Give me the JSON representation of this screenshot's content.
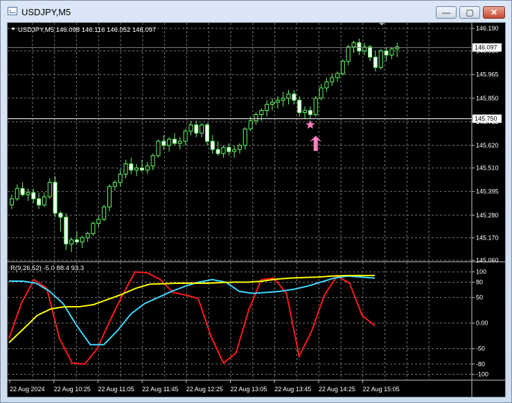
{
  "window": {
    "title": "USDJPY,M5",
    "minimize_label": "—",
    "maximize_label": "▢",
    "close_label": "✕"
  },
  "chart_data": [
    {
      "type": "candlestick",
      "header": "USDJPY,M5  146.098 146.116 146.052 146.097",
      "ylim": [
        145.06,
        146.19
      ],
      "yticks": [
        "146.190",
        "146.080",
        "145.965",
        "145.850",
        "145.735",
        "145.620",
        "145.510",
        "145.395",
        "145.280",
        "145.170",
        "145.060"
      ],
      "current_price_label": "146.097",
      "current_price": 146.097,
      "hline_label": "145.750",
      "hline_value": 145.75,
      "bullish_color": "#66ff66",
      "bearish_color": "#ffffff",
      "candles": [
        [
          145.33,
          145.38,
          145.31,
          145.36
        ],
        [
          145.36,
          145.43,
          145.35,
          145.41
        ],
        [
          145.41,
          145.44,
          145.37,
          145.38
        ],
        [
          145.38,
          145.41,
          145.35,
          145.39
        ],
        [
          145.39,
          145.41,
          145.34,
          145.36
        ],
        [
          145.36,
          145.39,
          145.31,
          145.33
        ],
        [
          145.33,
          145.39,
          145.32,
          145.37
        ],
        [
          145.37,
          145.46,
          145.36,
          145.44
        ],
        [
          145.44,
          145.47,
          145.27,
          145.29
        ],
        [
          145.29,
          145.3,
          145.2,
          145.27
        ],
        [
          145.27,
          145.29,
          145.11,
          145.14
        ],
        [
          145.14,
          145.17,
          145.1,
          145.16
        ],
        [
          145.16,
          145.2,
          145.14,
          145.15
        ],
        [
          145.15,
          145.18,
          145.12,
          145.17
        ],
        [
          145.17,
          145.2,
          145.15,
          145.19
        ],
        [
          145.19,
          145.25,
          145.18,
          145.24
        ],
        [
          145.24,
          145.28,
          145.22,
          145.26
        ],
        [
          145.26,
          145.33,
          145.25,
          145.32
        ],
        [
          145.32,
          145.43,
          145.3,
          145.42
        ],
        [
          145.42,
          145.45,
          145.4,
          145.44
        ],
        [
          145.44,
          145.5,
          145.42,
          145.48
        ],
        [
          145.48,
          145.55,
          145.46,
          145.53
        ],
        [
          145.53,
          145.56,
          145.48,
          145.5
        ],
        [
          145.5,
          145.53,
          145.47,
          145.51
        ],
        [
          145.51,
          145.55,
          145.49,
          145.5
        ],
        [
          145.5,
          145.54,
          145.48,
          145.52
        ],
        [
          145.52,
          145.58,
          145.5,
          145.57
        ],
        [
          145.57,
          145.65,
          145.56,
          145.64
        ],
        [
          145.64,
          145.67,
          145.6,
          145.62
        ],
        [
          145.62,
          145.66,
          145.59,
          145.65
        ],
        [
          145.65,
          145.68,
          145.62,
          145.63
        ],
        [
          145.63,
          145.66,
          145.6,
          145.64
        ],
        [
          145.64,
          145.7,
          145.62,
          145.69
        ],
        [
          145.69,
          145.74,
          145.67,
          145.72
        ],
        [
          145.72,
          145.74,
          145.66,
          145.68
        ],
        [
          145.68,
          145.73,
          145.66,
          145.72
        ],
        [
          145.72,
          145.73,
          145.62,
          145.64
        ],
        [
          145.64,
          145.67,
          145.58,
          145.6
        ],
        [
          145.6,
          145.64,
          145.57,
          145.58
        ],
        [
          145.58,
          145.62,
          145.56,
          145.61
        ],
        [
          145.61,
          145.63,
          145.57,
          145.59
        ],
        [
          145.59,
          145.62,
          145.56,
          145.6
        ],
        [
          145.6,
          145.63,
          145.58,
          145.62
        ],
        [
          145.62,
          145.71,
          145.6,
          145.7
        ],
        [
          145.7,
          145.76,
          145.69,
          145.74
        ],
        [
          145.74,
          145.78,
          145.72,
          145.77
        ],
        [
          145.77,
          145.8,
          145.74,
          145.79
        ],
        [
          145.79,
          145.84,
          145.76,
          145.82
        ],
        [
          145.82,
          145.85,
          145.79,
          145.83
        ],
        [
          145.83,
          145.86,
          145.8,
          145.84
        ],
        [
          145.84,
          145.88,
          145.81,
          145.85
        ],
        [
          145.85,
          145.89,
          145.82,
          145.87
        ],
        [
          145.87,
          145.89,
          145.82,
          145.84
        ],
        [
          145.84,
          145.86,
          145.76,
          145.78
        ],
        [
          145.78,
          145.81,
          145.75,
          145.79
        ],
        [
          145.79,
          145.81,
          145.75,
          145.77
        ],
        [
          145.77,
          145.86,
          145.76,
          145.85
        ],
        [
          145.85,
          145.92,
          145.84,
          145.9
        ],
        [
          145.9,
          145.95,
          145.88,
          145.93
        ],
        [
          145.93,
          145.97,
          145.91,
          145.95
        ],
        [
          145.95,
          145.98,
          145.93,
          145.97
        ],
        [
          145.97,
          146.04,
          145.96,
          146.03
        ],
        [
          146.03,
          146.11,
          146.01,
          146.1
        ],
        [
          146.1,
          146.13,
          146.07,
          146.12
        ],
        [
          146.12,
          146.14,
          146.06,
          146.08
        ],
        [
          146.08,
          146.12,
          146.06,
          146.1
        ],
        [
          146.1,
          146.11,
          146.03,
          146.05
        ],
        [
          146.05,
          146.08,
          145.98,
          146.0
        ],
        [
          146.0,
          146.09,
          145.99,
          146.08
        ],
        [
          146.08,
          146.1,
          146.03,
          146.06
        ],
        [
          146.06,
          146.1,
          146.04,
          146.09
        ],
        [
          146.09,
          146.12,
          146.05,
          146.1
        ]
      ],
      "markers": [
        {
          "type": "star",
          "index": 55,
          "value": 145.72,
          "color": "#ff80c0"
        },
        {
          "type": "arrow-up",
          "index": 56,
          "value": 145.63,
          "color": "#ff80c0"
        }
      ]
    },
    {
      "type": "line",
      "header": "R(9,26,52) -5.0 88.4 93.3",
      "ylim": [
        -110,
        105
      ],
      "yticks": [
        "100",
        "80",
        "50",
        "0.00",
        "-50",
        "-80",
        "-100"
      ],
      "series": [
        {
          "color": "#ff1a1a",
          "values": [
            -30,
            40,
            85,
            68,
            -30,
            -78,
            -80,
            -50,
            5,
            55,
            100,
            98,
            85,
            60,
            55,
            48,
            -25,
            -78,
            -58,
            25,
            85,
            88,
            58,
            -65,
            -15,
            55,
            92,
            78,
            15,
            -5
          ]
        },
        {
          "color": "#40d8ff",
          "values": [
            82,
            82,
            78,
            62,
            38,
            -5,
            -42,
            -42,
            -15,
            18,
            38,
            50,
            62,
            72,
            80,
            85,
            80,
            62,
            58,
            60,
            62,
            66,
            72,
            80,
            88,
            92,
            90,
            88
          ]
        },
        {
          "color": "#ffff00",
          "values": [
            -38,
            -12,
            15,
            28,
            32,
            32,
            36,
            46,
            56,
            68,
            76,
            77,
            78,
            78,
            78,
            79,
            80,
            80,
            82,
            86,
            88,
            89,
            90,
            92,
            93,
            93,
            93
          ]
        }
      ]
    }
  ],
  "time_axis": {
    "labels": [
      "22 Aug 2024",
      "22 Aug 10:25",
      "22 Aug 11:05",
      "22 Aug 11:45",
      "22 Aug 12:25",
      "22 Aug 13:05",
      "22 Aug 13:45",
      "22 Aug 14:25",
      "22 Aug 15:05"
    ]
  }
}
